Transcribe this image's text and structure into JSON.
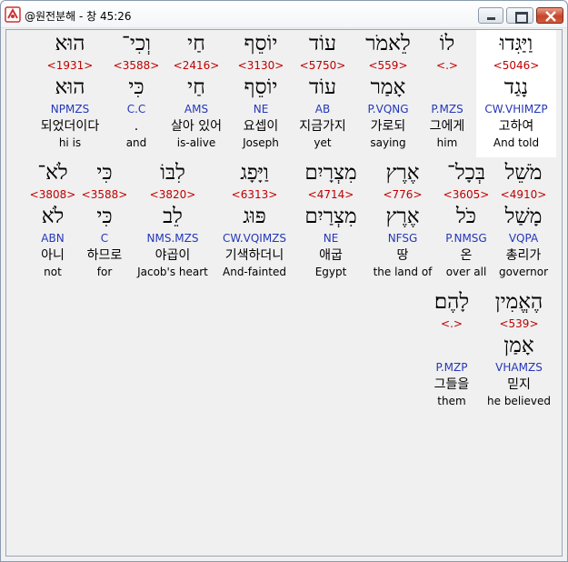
{
  "window": {
    "title": "@원전분해 - 창 45:26"
  },
  "rows": [
    {
      "words": [
        {
          "heb": "וַיַּגִּדוּ",
          "strong": "<5046>",
          "lemma": "נָגַד",
          "morph": "CW.VHIMZP",
          "korean": "고하여",
          "english": "And told",
          "selected": true
        },
        {
          "heb": "לוֹ",
          "strong": "<.>",
          "lemma": "",
          "morph": "P.MZS",
          "korean": "그에게",
          "english": "him"
        },
        {
          "heb": "לֵאמֹר",
          "strong": "<559>",
          "lemma": "אָמַר",
          "morph": "P.VQNG",
          "korean": "가로되",
          "english": "saying"
        },
        {
          "heb": "עוֹד",
          "strong": "<5750>",
          "lemma": "עוֹד",
          "morph": "AB",
          "korean": "지금가지",
          "english": "yet"
        },
        {
          "heb": "יוֹסֵף",
          "strong": "<3130>",
          "lemma": "יוֹסֵף",
          "morph": "NE",
          "korean": "요셉이",
          "english": "Joseph"
        },
        {
          "heb": "חַי",
          "strong": "<2416>",
          "lemma": "חַי",
          "morph": "AMS",
          "korean": "살아 있어",
          "english": "is-alive"
        },
        {
          "heb": "וְכִי־",
          "strong": "<3588>",
          "lemma": "כִּי",
          "morph": "C.C",
          "korean": "",
          "english": "and"
        },
        {
          "heb": "הוּא",
          "strong": "<1931>",
          "lemma": "הוּא",
          "morph": "NPMZS",
          "korean": "되었더이다",
          "english": "hi is"
        }
      ]
    },
    {
      "words": [
        {
          "heb": "מֹשֵׁל",
          "strong": "<4910>",
          "lemma": "מָשַׁל",
          "morph": "VQPA",
          "korean": "총리가",
          "english": "governor"
        },
        {
          "heb": "בְּכָל־",
          "strong": "<3605>",
          "lemma": "כֹּל",
          "morph": "P.NMSG",
          "korean": "온",
          "english": "over all"
        },
        {
          "heb": "אֶרֶץ",
          "strong": "<776>",
          "lemma": "אֶרֶץ",
          "morph": "NFSG",
          "korean": "땅",
          "english": "the land of"
        },
        {
          "heb": "מִצְרָיִם",
          "strong": "<4714>",
          "lemma": "מִצְרַיִם",
          "morph": "NE",
          "korean": "애굽",
          "english": "Egypt"
        },
        {
          "heb": "וַיָּפָג",
          "strong": "<6313>",
          "lemma": "פּוּג",
          "morph": "CW.VQIMZS",
          "korean": "기색하더니",
          "english": "And-fainted"
        },
        {
          "heb": "לִבּוֹ",
          "strong": "<3820>",
          "lemma": "לֵב",
          "morph": "NMS.MZS",
          "korean": "야곱이",
          "english": "Jacob's heart"
        },
        {
          "heb": "כִּי",
          "strong": "<3588>",
          "lemma": "כִּי",
          "morph": "C",
          "korean": "하므로",
          "english": "for"
        },
        {
          "heb": "לֹא־",
          "strong": "<3808>",
          "lemma": "לֹא",
          "morph": "ABN",
          "korean": "아니",
          "english": "not"
        }
      ]
    },
    {
      "words": [
        {
          "heb": "הֶאֱמִין",
          "strong": "<539>",
          "lemma": "אָמַן",
          "morph": "VHAMZS",
          "korean": "믿지",
          "english": "he believed"
        },
        {
          "heb": "לָהֶם׃",
          "strong": "<.>",
          "lemma": "",
          "morph": "P.MZP",
          "korean": "그들을",
          "english": "them"
        }
      ]
    }
  ]
}
